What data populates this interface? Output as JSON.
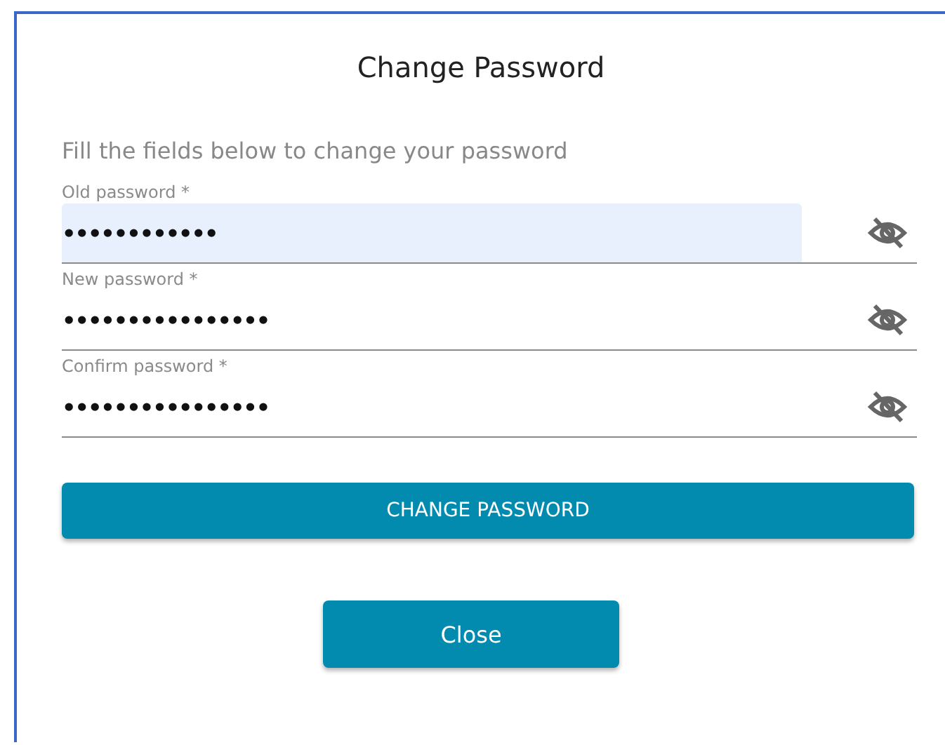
{
  "dialog": {
    "title": "Change Password",
    "instructions": "Fill the fields below to change your password",
    "fields": [
      {
        "label": "Old password *",
        "value": "••••••••••••",
        "autofilled": true
      },
      {
        "label": "New password *",
        "value": "••••••••••••••••",
        "autofilled": false
      },
      {
        "label": "Confirm password *",
        "value": "••••••••••••••••",
        "autofilled": false
      }
    ],
    "submit_button": "CHANGE PASSWORD",
    "close_button": "Close"
  }
}
